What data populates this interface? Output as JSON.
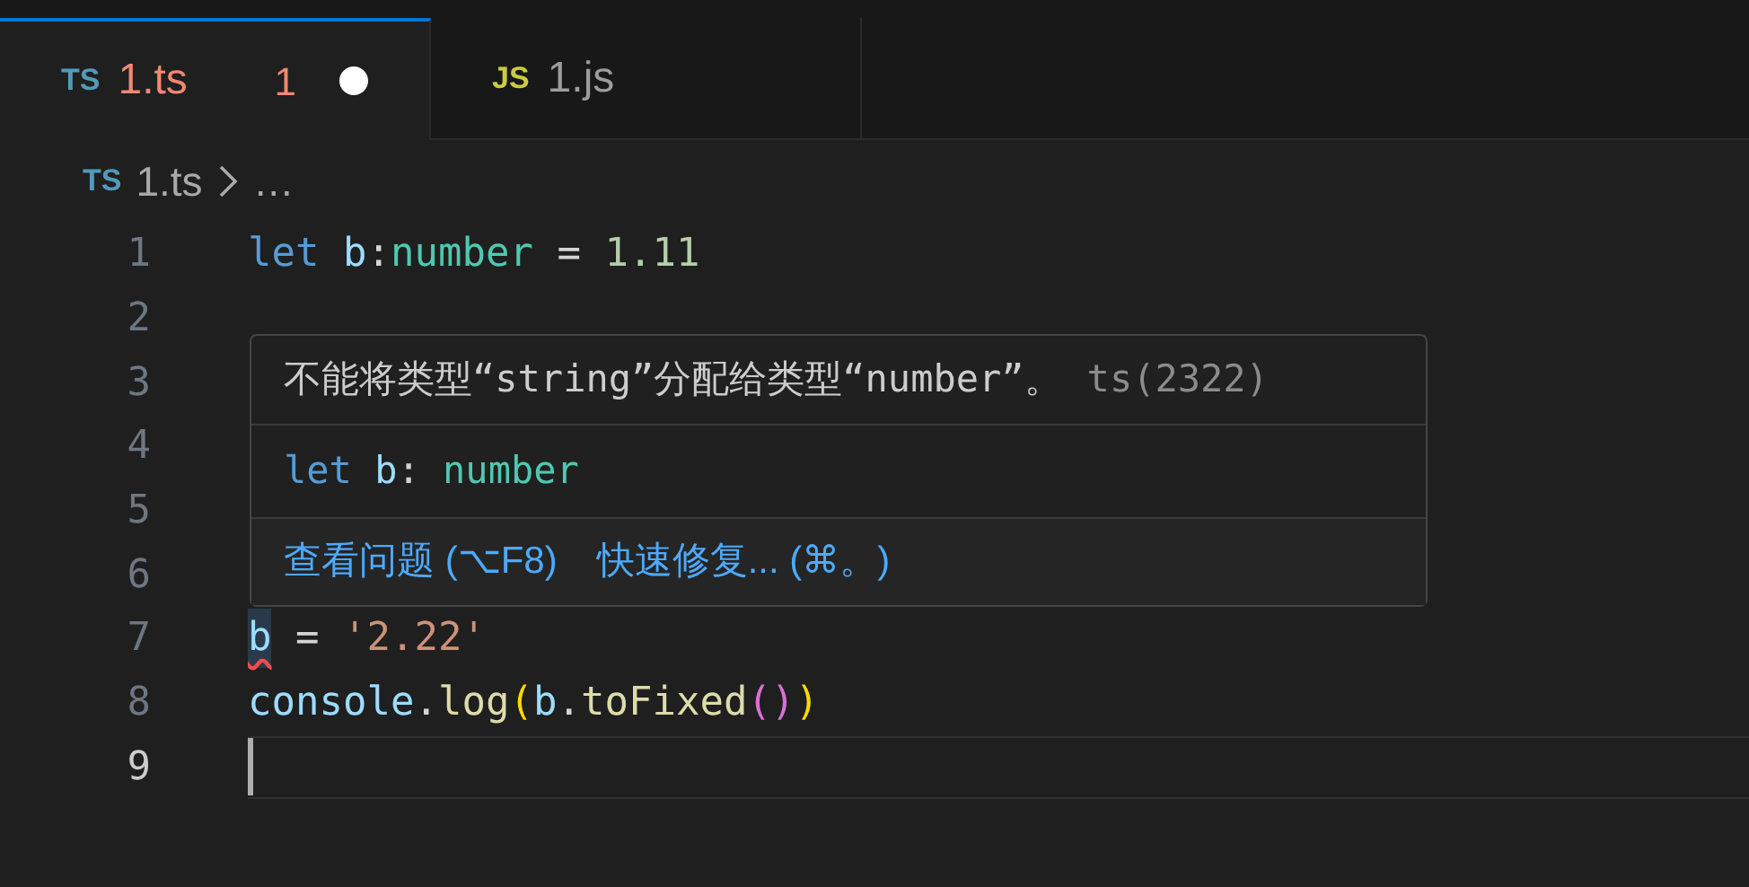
{
  "tabs": [
    {
      "badge": "TS",
      "kind": "ts",
      "label": "1.ts",
      "selected": true,
      "error_count": "1",
      "dirty": true
    },
    {
      "badge": "JS",
      "kind": "js",
      "label": "1.js",
      "selected": false,
      "dirty": false
    }
  ],
  "breadcrumb": {
    "badge": "TS",
    "file": "1.ts",
    "rest": "…"
  },
  "editor": {
    "lines": [
      {
        "number": "1",
        "current": false,
        "tokens": [
          {
            "text": "let",
            "kind": "keyword"
          },
          {
            "text": " b",
            "kind": "variable"
          },
          {
            "text": ":",
            "kind": "plain"
          },
          {
            "text": "number",
            "kind": "type"
          },
          {
            "text": " = ",
            "kind": "plain"
          },
          {
            "text": "1.11",
            "kind": "number"
          }
        ]
      },
      {
        "number": "2",
        "current": false
      },
      {
        "number": "3",
        "current": false
      },
      {
        "number": "4",
        "current": false
      },
      {
        "number": "5",
        "current": false
      },
      {
        "number": "6",
        "current": false
      },
      {
        "number": "7",
        "current": false,
        "tokens": [
          {
            "text": "b",
            "kind": "variable",
            "error": true
          },
          {
            "text": " = ",
            "kind": "plain"
          },
          {
            "text": "'2.22'",
            "kind": "string"
          }
        ]
      },
      {
        "number": "8",
        "current": false,
        "tokens": [
          {
            "text": "console",
            "kind": "variable"
          },
          {
            "text": ".",
            "kind": "plain"
          },
          {
            "text": "log",
            "kind": "function"
          },
          {
            "text": "(",
            "kind": "bracket1"
          },
          {
            "text": "b",
            "kind": "variable"
          },
          {
            "text": ".",
            "kind": "plain"
          },
          {
            "text": "toFixed",
            "kind": "function"
          },
          {
            "text": "()",
            "kind": "bracket2"
          },
          {
            "text": ")",
            "kind": "bracket1"
          }
        ]
      },
      {
        "number": "9",
        "current": true
      }
    ]
  },
  "hover": {
    "message": "不能将类型“string”分配给类型“number”。",
    "code": "ts(2322)",
    "signature": [
      {
        "text": "let",
        "kind": "keyword"
      },
      {
        "text": " b",
        "kind": "variable"
      },
      {
        "text": ": ",
        "kind": "plain"
      },
      {
        "text": "number",
        "kind": "type"
      }
    ],
    "actions": [
      "查看问题 (⌥F8)",
      "快速修复... (⌘。)"
    ]
  }
}
